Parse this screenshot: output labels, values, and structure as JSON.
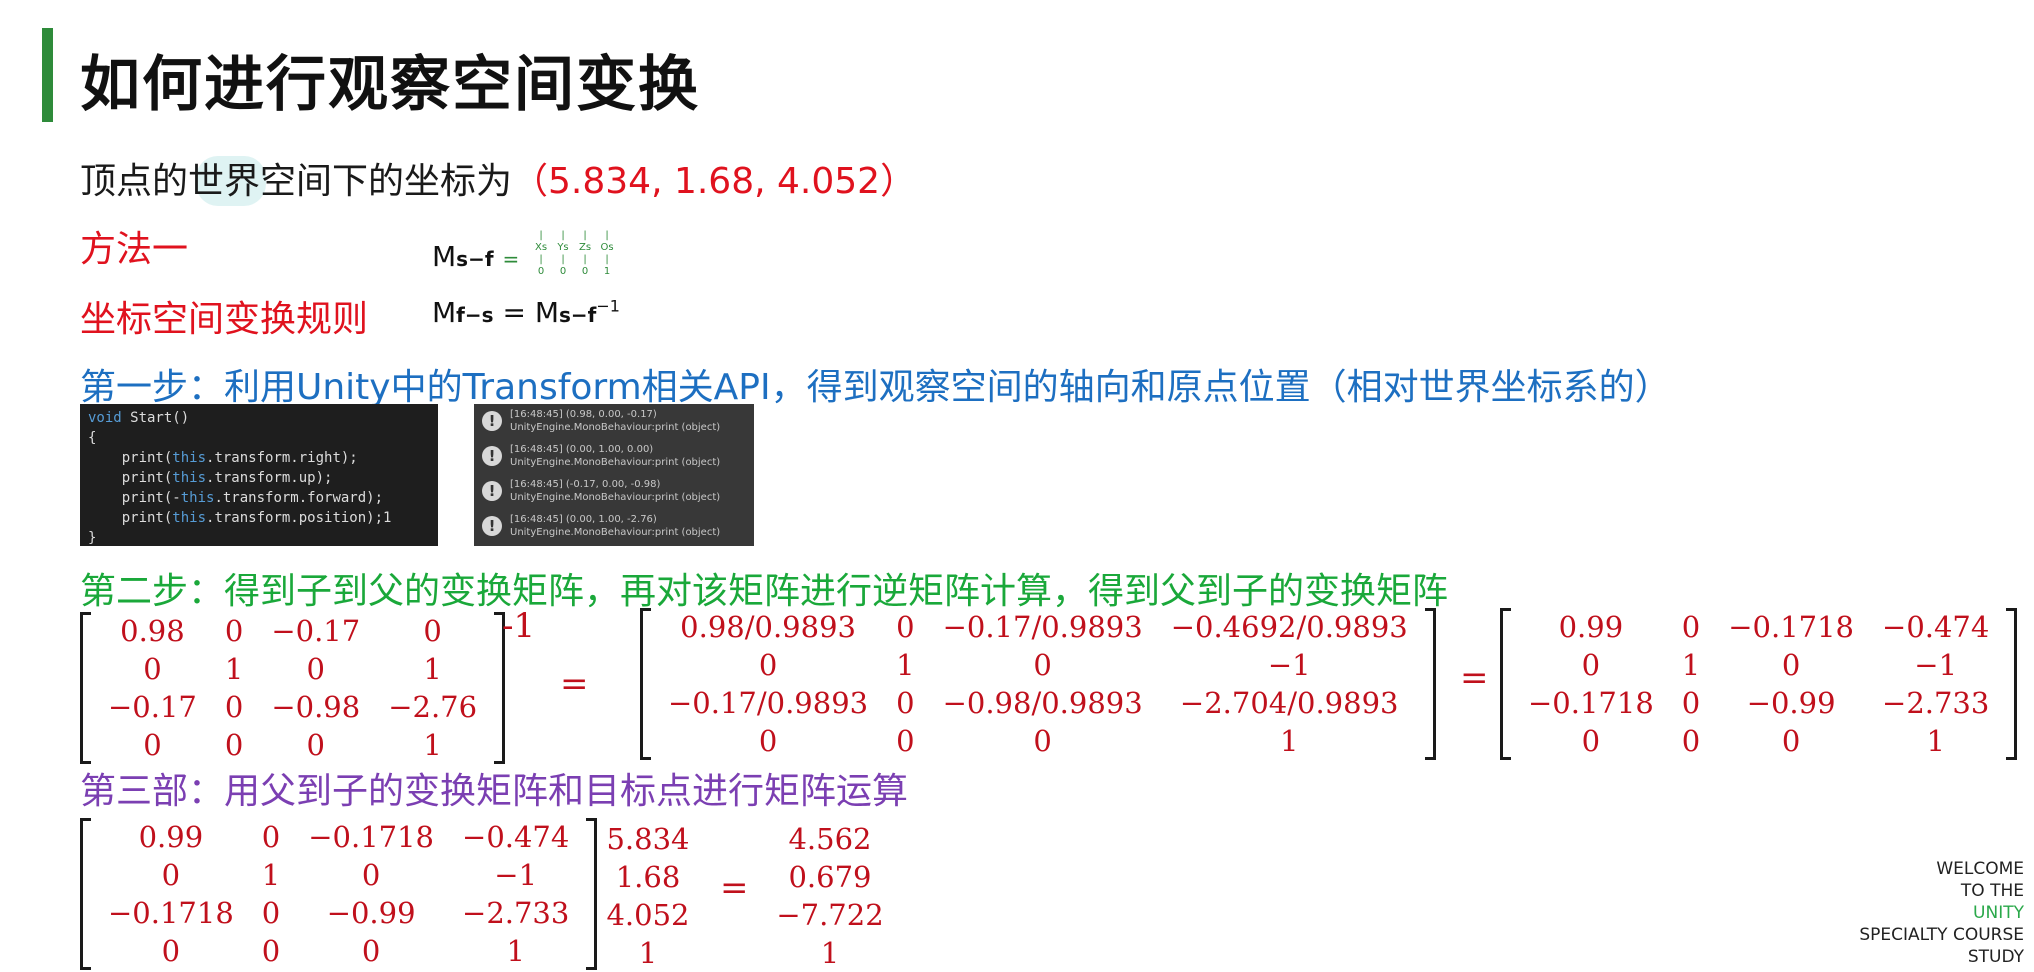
{
  "title": "如何进行观察空间变换",
  "line1": {
    "text": "顶点的世界空间下的坐标为",
    "coords": "（5.834, 1.68, 4.052）"
  },
  "method1": "方法一",
  "rule": "坐标空间变换规则",
  "formula1": {
    "m": "M",
    "sub": "s−f",
    "eq": "="
  },
  "formula2": {
    "lhs_m": "M",
    "lhs_sub": "f−s",
    "eq": "=",
    "rhs_m": "M",
    "rhs_sub": "s−f",
    "sup": "−1"
  },
  "tiny_matrix": {
    "row1": [
      "|",
      "|",
      "|",
      "|"
    ],
    "row2": [
      "Xs",
      "Ys",
      "Zs",
      "Os"
    ],
    "row3": [
      "|",
      "|",
      "|",
      "|"
    ],
    "row4": [
      "0",
      "0",
      "0",
      "1"
    ]
  },
  "step1": "第一步：利用Unity中的Transform相关API，得到观察空间的轴向和原点位置（相对世界坐标系的）",
  "code": {
    "l1a": "void",
    "l1b": " Start()",
    "l2": "{",
    "l3a": "    print(",
    "l3b": "this",
    "l3c": ".transform.right);",
    "l4a": "    print(",
    "l4b": "this",
    "l4c": ".transform.up);",
    "l5a": "    print(-",
    "l5b": "this",
    "l5c": ".transform.forward);",
    "l6a": "    print(",
    "l6b": "this",
    "l6c": ".transform.position);1",
    "l7": "}"
  },
  "console_logs": [
    {
      "icon": "!",
      "line1": "[16:48:45] (0.98, 0.00, -0.17)",
      "line2": "UnityEngine.MonoBehaviour:print (object)"
    },
    {
      "icon": "!",
      "line1": "[16:48:45] (0.00, 1.00, 0.00)",
      "line2": "UnityEngine.MonoBehaviour:print (object)"
    },
    {
      "icon": "!",
      "line1": "[16:48:45] (-0.17, 0.00, -0.98)",
      "line2": "UnityEngine.MonoBehaviour:print (object)"
    },
    {
      "icon": "!",
      "line1": "[16:48:45] (0.00, 1.00, -2.76)",
      "line2": "UnityEngine.MonoBehaviour:print (object)"
    }
  ],
  "step2": "第二步：得到子到父的变换矩阵，再对该矩阵进行逆矩阵计算，得到父到子的变换矩阵",
  "matrixA": [
    [
      "0.98",
      "0",
      "−0.17",
      "0"
    ],
    [
      "0",
      "1",
      "0",
      "1"
    ],
    [
      "−0.17",
      "0",
      "−0.98",
      "−2.76"
    ],
    [
      "0",
      "0",
      "0",
      "1"
    ]
  ],
  "inverse_mark": "-1",
  "matrixB": [
    [
      "0.98/0.9893",
      "0",
      "−0.17/0.9893",
      "−0.4692/0.9893"
    ],
    [
      "0",
      "1",
      "0",
      "−1"
    ],
    [
      "−0.17/0.9893",
      "0",
      "−0.98/0.9893",
      "−2.704/0.9893"
    ],
    [
      "0",
      "0",
      "0",
      "1"
    ]
  ],
  "matrixC": [
    [
      "0.99",
      "0",
      "−0.1718",
      "−0.474"
    ],
    [
      "0",
      "1",
      "0",
      "−1"
    ],
    [
      "−0.1718",
      "0",
      "−0.99",
      "−2.733"
    ],
    [
      "0",
      "0",
      "0",
      "1"
    ]
  ],
  "equals": "=",
  "step3": "第三部：用父到子的变换矩阵和目标点进行矩阵运算",
  "matrixD": [
    [
      "0.99",
      "0",
      "−0.1718",
      "−0.474"
    ],
    [
      "0",
      "1",
      "0",
      "−1"
    ],
    [
      "−0.1718",
      "0",
      "−0.99",
      "−2.733"
    ],
    [
      "0",
      "0",
      "0",
      "1"
    ]
  ],
  "vector_in": [
    "5.834",
    "1.68",
    "4.052",
    "1"
  ],
  "vector_out": [
    "4.562",
    "0.679",
    "−7.722",
    "1"
  ],
  "brand": {
    "l1": "WELCOME",
    "l2": "TO THE",
    "l3": "UNITY",
    "l4": "SPECIALTY COURSE",
    "l5": "STUDY"
  }
}
